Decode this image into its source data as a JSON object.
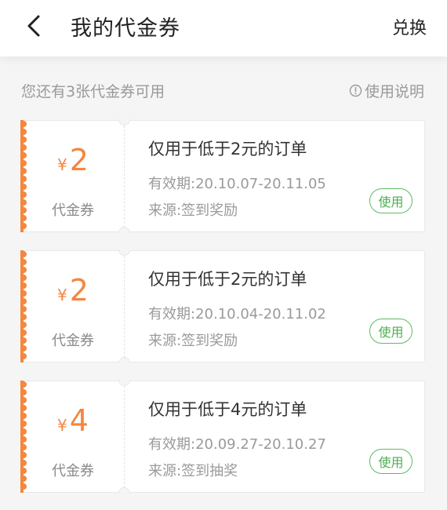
{
  "header": {
    "title": "我的代金券",
    "exchange_label": "兑换"
  },
  "info": {
    "available_text": "您还有3张代金券可用",
    "help_label": "使用说明"
  },
  "coupons": [
    {
      "currency": "¥",
      "amount": "2",
      "type_label": "代金券",
      "condition": "仅用于低于2元的订单",
      "validity": "有效期:20.10.07-20.11.05",
      "source": "来源:签到奖励",
      "use_label": "使用"
    },
    {
      "currency": "¥",
      "amount": "2",
      "type_label": "代金券",
      "condition": "仅用于低于2元的订单",
      "validity": "有效期:20.10.04-20.11.02",
      "source": "来源:签到奖励",
      "use_label": "使用"
    },
    {
      "currency": "¥",
      "amount": "4",
      "type_label": "代金券",
      "condition": "仅用于低于4元的订单",
      "validity": "有效期:20.09.27-20.10.27",
      "source": "来源:签到抽奖",
      "use_label": "使用"
    }
  ],
  "colors": {
    "accent_orange": "#f5863f",
    "use_green": "#4caf50",
    "muted_text": "#9a9a9a"
  },
  "icons": {
    "back": "back-arrow-icon",
    "help": "info-circle-icon"
  }
}
